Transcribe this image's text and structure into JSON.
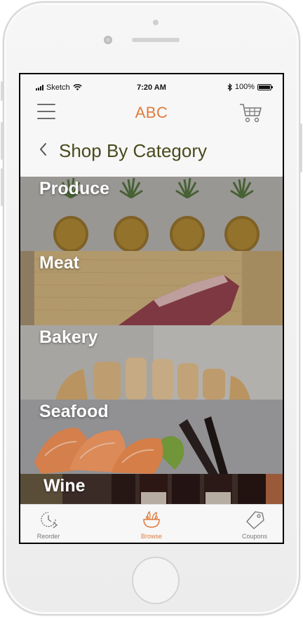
{
  "status_bar": {
    "carrier": "Sketch",
    "time": "7:20 AM",
    "battery": "100%"
  },
  "header": {
    "brand": "ABC"
  },
  "page": {
    "title": "Shop By Category"
  },
  "categories": [
    {
      "label": "Produce"
    },
    {
      "label": "Meat"
    },
    {
      "label": "Bakery"
    },
    {
      "label": "Seafood"
    },
    {
      "label": "Wine"
    }
  ],
  "tabs": [
    {
      "label": "Reorder"
    },
    {
      "label": "Browse"
    },
    {
      "label": "Coupons"
    }
  ],
  "colors": {
    "accent": "#e07b3c",
    "title": "#4a4a1e"
  },
  "icons": [
    "signal-icon",
    "wifi-icon",
    "bluetooth-icon",
    "battery-icon",
    "menu-icon",
    "cart-icon",
    "back-chevron-icon",
    "reorder-clock-icon",
    "browse-bowl-icon",
    "coupon-tag-icon"
  ]
}
